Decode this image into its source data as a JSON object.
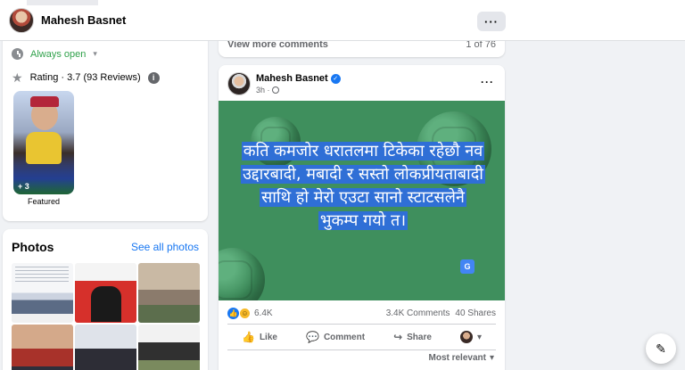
{
  "header": {
    "name": "Mahesh Basnet",
    "more_label": "···"
  },
  "intro": {
    "hours": "Always open",
    "rating": "Rating · 3.7 (93 Reviews)",
    "featured_count": "+ 3",
    "featured_label": "Featured",
    "icons": {
      "clock": "clock-icon",
      "star": "star-icon",
      "info": "info-icon"
    }
  },
  "photos": {
    "title": "Photos",
    "see_all": "See all photos"
  },
  "comments_bar": {
    "view_more": "View more comments",
    "count": "1 of 76"
  },
  "post": {
    "author": "Mahesh Basnet",
    "time": "3h ·",
    "more_label": "···",
    "text": "कति कमजोर धरातलमा टिकेका रहेछौ नव उद्दारबादी, मबादी र सस्तो लोकप्रीयताबादी साथि हो मेरो एउटा सानो स्टाटसलेनै भुकम्प गयो त।",
    "reaction_count": "6.4K",
    "comments": "3.4K Comments",
    "shares": "40 Shares",
    "actions": {
      "like": "Like",
      "comment": "Comment",
      "share": "Share"
    },
    "sort": "Most relevant"
  },
  "colors": {
    "accent": "#1877f2",
    "open_green": "#31a24c",
    "post_bg": "#3f8f5d",
    "highlight": "#2f6fd6"
  }
}
